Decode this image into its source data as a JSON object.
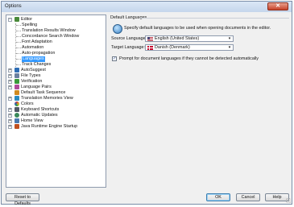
{
  "window": {
    "title": "Options",
    "close_glyph": "✕"
  },
  "tree": {
    "items": [
      {
        "label": "Editor",
        "level": 0,
        "expander": "−",
        "icon": "editor-icon",
        "color": "#4a8a3a",
        "selected": false
      },
      {
        "label": "Spelling",
        "level": 1,
        "selected": false
      },
      {
        "label": "Translation Results Window",
        "level": 1,
        "selected": false
      },
      {
        "label": "Concordance Search Window",
        "level": 1,
        "selected": false
      },
      {
        "label": "Font Adaptation",
        "level": 1,
        "selected": false
      },
      {
        "label": "Automation",
        "level": 1,
        "selected": false
      },
      {
        "label": "Auto-propagation",
        "level": 1,
        "selected": false
      },
      {
        "label": "Languages",
        "level": 1,
        "selected": true
      },
      {
        "label": "Track Changes",
        "level": 1,
        "selected": false
      },
      {
        "label": "AutoSuggest",
        "level": 0,
        "expander": "+",
        "icon": "autosuggest-icon",
        "color": "#2e6db4"
      },
      {
        "label": "File Types",
        "level": 0,
        "expander": "+",
        "icon": "file-types-icon",
        "color": "#6a7fa0"
      },
      {
        "label": "Verification",
        "level": 0,
        "expander": "+",
        "icon": "verification-icon",
        "color": "#3a9a3a"
      },
      {
        "label": "Language Pairs",
        "level": 0,
        "expander": "+",
        "icon": "language-pairs-icon",
        "color": "#b04a9a"
      },
      {
        "label": "Default Task Sequence",
        "level": 0,
        "expander": "",
        "icon": "task-sequence-icon",
        "color": "#d08a20"
      },
      {
        "label": "Translation Memories View",
        "level": 0,
        "expander": "+",
        "icon": "translation-memories-icon",
        "color": "#2a8ac0"
      },
      {
        "label": "Colors",
        "level": 0,
        "expander": "",
        "icon": "colors-icon",
        "color": "#c03a3a"
      },
      {
        "label": "Keyboard Shortcuts",
        "level": 0,
        "expander": "+",
        "icon": "keyboard-icon",
        "color": "#505a66"
      },
      {
        "label": "Automatic Updates",
        "level": 0,
        "expander": "+",
        "icon": "updates-icon",
        "color": "#3a8a5a"
      },
      {
        "label": "Home View",
        "level": 0,
        "expander": "+",
        "icon": "home-view-icon",
        "color": "#4a7ab0"
      },
      {
        "label": "Java Runtime Engine Startup",
        "level": 0,
        "expander": "+",
        "icon": "java-icon",
        "color": "#c05020"
      }
    ]
  },
  "panel": {
    "section_title": "Default Languages",
    "description": "Specify default languages to be used when opening documents in the editor.",
    "source": {
      "label": "Source Language:",
      "value": "English (United States)",
      "flag": "us-flag"
    },
    "target": {
      "label": "Target Language:",
      "value": "Danish (Denmark)",
      "flag": "dk-flag"
    },
    "dropdown_arrow": "▾",
    "prompt": {
      "checked": true,
      "glyph": "✓",
      "label": "Prompt for document languages if they cannot be detected automatically"
    }
  },
  "buttons": {
    "reset": "Reset to Defaults",
    "ok": "OK",
    "cancel": "Cancel",
    "help": "Help"
  },
  "colors": {
    "selection": "#3399ff",
    "accent_border": "#3c7fb1"
  }
}
